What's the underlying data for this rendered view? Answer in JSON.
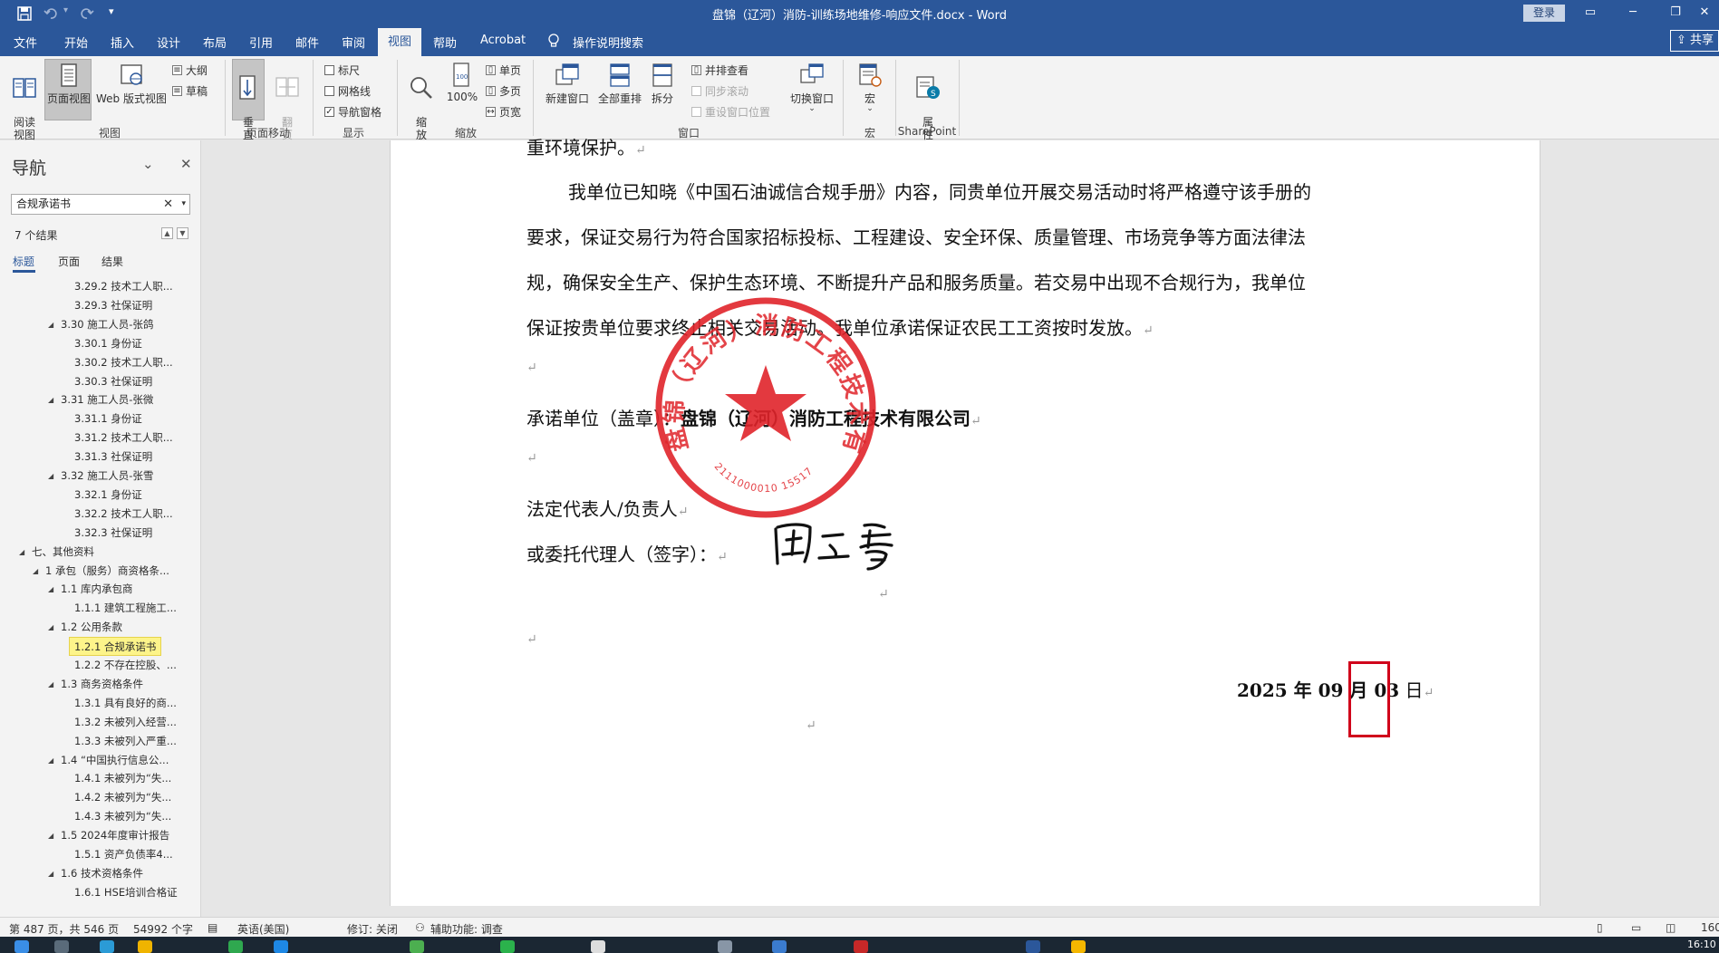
{
  "window": {
    "title": "盘锦（辽河）消防-训练场地维修-响应文件.docx  -  Word",
    "login_label": "登录",
    "share_label": "共享",
    "quick_access_more": "▾"
  },
  "menu": {
    "tabs": [
      "文件",
      "开始",
      "插入",
      "设计",
      "布局",
      "引用",
      "邮件",
      "审阅",
      "视图",
      "帮助",
      "Acrobat"
    ],
    "active_tab": "视图",
    "tell_me": "操作说明搜索"
  },
  "ribbon": {
    "views": {
      "read_mode": "阅读\n视图",
      "print_layout": "页面视图",
      "web_layout": "Web 版式视图",
      "outline": "大纲",
      "draft": "草稿",
      "group": "视图"
    },
    "page_movement": {
      "vertical": "垂\n直",
      "side_to_side": "翻\n页",
      "group": "页面移动"
    },
    "show": {
      "ruler": "标尺",
      "gridlines": "网格线",
      "nav_pane": "导航窗格",
      "ruler_checked": false,
      "gridlines_checked": false,
      "nav_pane_checked": true,
      "group": "显示"
    },
    "zoom": {
      "zoom": "缩\n放",
      "hundred": "100%",
      "one_page": "单页",
      "multi_page": "多页",
      "page_width": "页宽",
      "group": "缩放"
    },
    "window": {
      "new_window": "新建窗口",
      "arrange_all": "全部重排",
      "split": "拆分",
      "side_by_side": "并排查看",
      "sync_scroll": "同步滚动",
      "reset_position": "重设窗口位置",
      "switch_windows": "切换窗口",
      "group": "窗口"
    },
    "macros": {
      "macros": "宏",
      "group": "宏"
    },
    "sharepoint": {
      "properties": "属\n性",
      "group": "SharePoint"
    }
  },
  "nav": {
    "title": "导航",
    "search_value": "合规承诺书",
    "results": "7 个结果",
    "tabs": [
      "标题",
      "页面",
      "结果"
    ],
    "items": [
      {
        "label": "3.29.2 技术工人职...",
        "level": 3,
        "expand": false
      },
      {
        "label": "3.29.3 社保证明",
        "level": 3,
        "expand": false
      },
      {
        "label": "3.30 施工人员-张鸽",
        "level": 2,
        "expand": true
      },
      {
        "label": "3.30.1 身份证",
        "level": 3,
        "expand": false
      },
      {
        "label": "3.30.2 技术工人职...",
        "level": 3,
        "expand": false
      },
      {
        "label": "3.30.3 社保证明",
        "level": 3,
        "expand": false
      },
      {
        "label": "3.31 施工人员-张微",
        "level": 2,
        "expand": true
      },
      {
        "label": "3.31.1 身份证",
        "level": 3,
        "expand": false
      },
      {
        "label": "3.31.2 技术工人职...",
        "level": 3,
        "expand": false
      },
      {
        "label": "3.31.3 社保证明",
        "level": 3,
        "expand": false
      },
      {
        "label": "3.32 施工人员-张雪",
        "level": 2,
        "expand": true
      },
      {
        "label": "3.32.1 身份证",
        "level": 3,
        "expand": false
      },
      {
        "label": "3.32.2 技术工人职...",
        "level": 3,
        "expand": false
      },
      {
        "label": "3.32.3 社保证明",
        "level": 3,
        "expand": false
      },
      {
        "label": "七、其他资料",
        "level": 0,
        "expand": true
      },
      {
        "label": "1 承包（服务）商资格条...",
        "level": 1,
        "expand": true
      },
      {
        "label": "1.1 库内承包商",
        "level": 2,
        "expand": true
      },
      {
        "label": "1.1.1 建筑工程施工...",
        "level": 3,
        "expand": false
      },
      {
        "label": "1.2 公用条款",
        "level": 2,
        "expand": true
      },
      {
        "label": "1.2.1 合规承诺书",
        "level": 3,
        "expand": false,
        "highlight": true
      },
      {
        "label": "1.2.2 不存在控股、...",
        "level": 3,
        "expand": false
      },
      {
        "label": "1.3 商务资格条件",
        "level": 2,
        "expand": true
      },
      {
        "label": "1.3.1 具有良好的商...",
        "level": 3,
        "expand": false
      },
      {
        "label": "1.3.2 未被列入经营...",
        "level": 3,
        "expand": false
      },
      {
        "label": "1.3.3 未被列入严重...",
        "level": 3,
        "expand": false
      },
      {
        "label": "1.4 “中国执行信息公...",
        "level": 2,
        "expand": true
      },
      {
        "label": "1.4.1 未被列为“失...",
        "level": 3,
        "expand": false
      },
      {
        "label": "1.4.2 未被列为“失...",
        "level": 3,
        "expand": false
      },
      {
        "label": "1.4.3 未被列为“失...",
        "level": 3,
        "expand": false
      },
      {
        "label": "1.5 2024年度审计报告",
        "level": 2,
        "expand": true
      },
      {
        "label": "1.5.1 资产负债率4...",
        "level": 3,
        "expand": false
      },
      {
        "label": "1.6 技术资格条件",
        "level": 2,
        "expand": true
      },
      {
        "label": "1.6.1 HSE培训合格证",
        "level": 3,
        "expand": false
      }
    ]
  },
  "doc": {
    "line0": "重环境保护。",
    "line1": "我单位已知晓《中国石油诚信合规手册》内容，同贵单位开展交易活动时将严格遵守该手册的",
    "line2": "要求，保证交易行为符合国家招标投标、工程建设、安全环保、质量管理、市场竞争等方面法律法",
    "line3": "规，确保安全生产、保护生态环境、不断提升产品和服务质量。若交易中出现不合规行为，我单位",
    "line4": "保证按贵单位要求终止相关交易活动。我单位承诺保证农民工工资按时发放。",
    "pledge_label": "承诺单位（盖章）：",
    "company": "盘锦（辽河）消防工程技术有限公司",
    "legal_rep": "法定代表人/负责人",
    "agent": "或委托代理人（签字）：",
    "date_year": "2025 年 09 月 ",
    "date_day": "03",
    "date_suffix": " 日",
    "para_mark": "↵",
    "seal_text": "盘锦（辽河）消防工程技术有限公司",
    "seal_number": "2111000010 15517"
  },
  "status": {
    "page": "第 487 页，共 546 页",
    "words": "54992 个字",
    "language": "英语(美国)",
    "track_changes": "修订: 关闭",
    "accessibility": "辅助功能: 调查",
    "zoom": "160",
    "time": "16:10"
  },
  "colors": {
    "brand": "#2b579a",
    "seal_red": "#e0242a",
    "highlight": "#fdf48a",
    "focus_box": "#d0021b"
  }
}
